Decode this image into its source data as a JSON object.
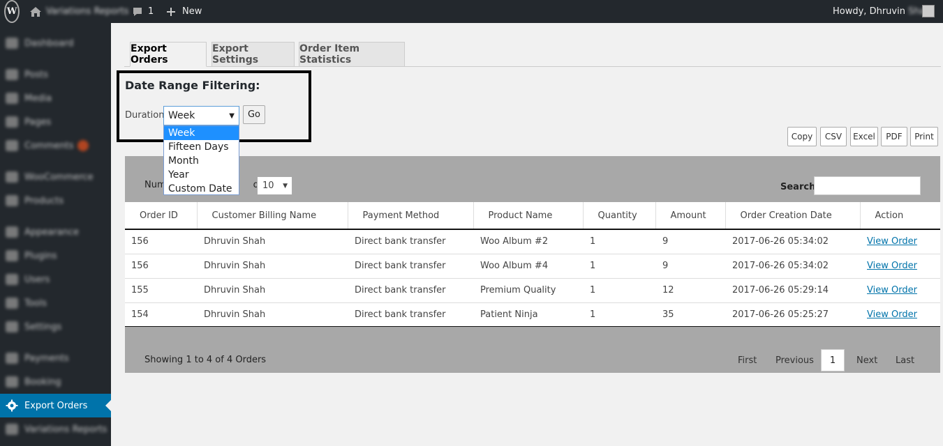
{
  "admin_bar": {
    "site_name": "Variations Reports",
    "comments_count": "1",
    "new_label": "New",
    "howdy": "Howdy, Dhruvin",
    "user_surname": "Shah"
  },
  "sidebar": {
    "items": [
      {
        "label": "Dashboard",
        "icon": "dashboard-icon"
      },
      {
        "label": "Posts",
        "icon": "pin-icon"
      },
      {
        "label": "Media",
        "icon": "media-icon"
      },
      {
        "label": "Pages",
        "icon": "pages-icon"
      },
      {
        "label": "Comments",
        "icon": "comment-icon"
      },
      {
        "label": "WooCommerce",
        "icon": "woo-icon"
      },
      {
        "label": "Products",
        "icon": "products-icon"
      },
      {
        "label": "Appearance",
        "icon": "brush-icon"
      },
      {
        "label": "Plugins",
        "icon": "plugin-icon"
      },
      {
        "label": "Users",
        "icon": "users-icon"
      },
      {
        "label": "Tools",
        "icon": "wrench-icon"
      },
      {
        "label": "Settings",
        "icon": "settings-icon"
      },
      {
        "label": "Payments",
        "icon": "cart-icon"
      },
      {
        "label": "Booking",
        "icon": "booking-icon"
      },
      {
        "label": "Export Orders",
        "icon": "gear-icon"
      },
      {
        "label": "Variations Reports",
        "icon": "gear-icon"
      }
    ],
    "accent_color": "#0073aa"
  },
  "tabs": [
    {
      "label": "Export Orders",
      "active": true
    },
    {
      "label": "Export Settings",
      "active": false
    },
    {
      "label": "Order Item Statistics",
      "active": false
    }
  ],
  "filter": {
    "title": "Date Range Filtering:",
    "duration_label": "Duration",
    "selected": "Week",
    "go_label": "Go",
    "options": [
      "Week",
      "Fifteen Days",
      "Month",
      "Year",
      "Custom Date"
    ]
  },
  "export_buttons": [
    "Copy",
    "CSV",
    "Excel",
    "PDF",
    "Print"
  ],
  "table_controls": {
    "show_label_start": "Num",
    "show_label_end": "ow:",
    "page_length": "10",
    "search_label": "Search:",
    "search_value": ""
  },
  "table": {
    "columns": [
      "Order ID",
      "Customer Billing Name",
      "Payment Method",
      "Product Name",
      "Quantity",
      "Amount",
      "Order Creation Date",
      "Action"
    ],
    "rows": [
      [
        "156",
        "Dhruvin Shah",
        "Direct bank transfer",
        "Woo Album #2",
        "1",
        "9",
        "2017-06-26 05:34:02",
        "View Order"
      ],
      [
        "156",
        "Dhruvin Shah",
        "Direct bank transfer",
        "Woo Album #4",
        "1",
        "9",
        "2017-06-26 05:34:02",
        "View Order"
      ],
      [
        "155",
        "Dhruvin Shah",
        "Direct bank transfer",
        "Premium Quality",
        "1",
        "12",
        "2017-06-26 05:29:14",
        "View Order"
      ],
      [
        "154",
        "Dhruvin Shah",
        "Direct bank transfer",
        "Patient Ninja",
        "1",
        "35",
        "2017-06-26 05:25:27",
        "View Order"
      ]
    ]
  },
  "pagination": {
    "info": "Showing 1 to 4 of 4 Orders",
    "first": "First",
    "previous": "Previous",
    "current": "1",
    "next": "Next",
    "last": "Last"
  }
}
